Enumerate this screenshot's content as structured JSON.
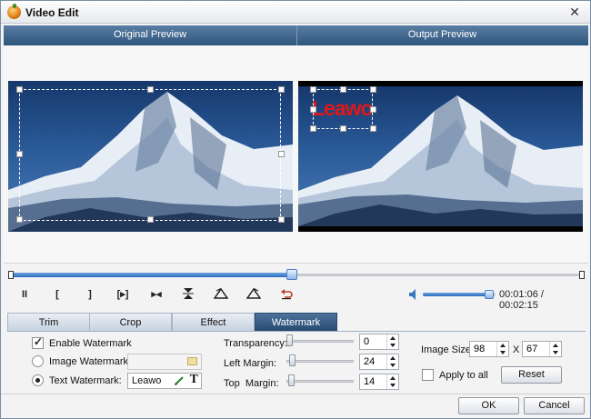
{
  "window": {
    "title": "Video Edit",
    "close_glyph": "✕"
  },
  "preview": {
    "original_label": "Original Preview",
    "output_label": "Output Preview",
    "watermark_text": "Leawo"
  },
  "timeline": {
    "progress": 0.492
  },
  "controls": {
    "pause": "II",
    "mark_in": "[",
    "mark_out": "]",
    "play_segment": "[▸]",
    "next_frame": "▸◂",
    "volume_level": 0.95,
    "current_time": "00:01:06",
    "separator": " / ",
    "total_time": "00:02:15"
  },
  "tabs": [
    {
      "label": "Trim",
      "active": false
    },
    {
      "label": "Crop",
      "active": false
    },
    {
      "label": "Effect",
      "active": false
    },
    {
      "label": "Watermark",
      "active": true
    }
  ],
  "watermark_panel": {
    "enable_label": "Enable Watermark",
    "enable_checked": true,
    "image_label": "Image Watermark:",
    "image_value": "",
    "text_label": "Text Watermark:",
    "text_value": "Leawo",
    "transparency_label": "Transparency:",
    "transparency_value": "0",
    "left_margin_label": "Left Margin:",
    "left_margin_value": "24",
    "top_margin_label": "Top  Margin:",
    "top_margin_value": "14",
    "image_size_label": "Image Size:",
    "image_width": "98",
    "size_x": "X",
    "image_height": "67",
    "apply_all_label": "Apply to all",
    "reset_label": "Reset"
  },
  "footer": {
    "ok_label": "OK",
    "cancel_label": "Cancel"
  },
  "colors": {
    "header_blue": "#2e557d",
    "watermark_red": "#e01818",
    "accent": "#2a6bbd"
  }
}
